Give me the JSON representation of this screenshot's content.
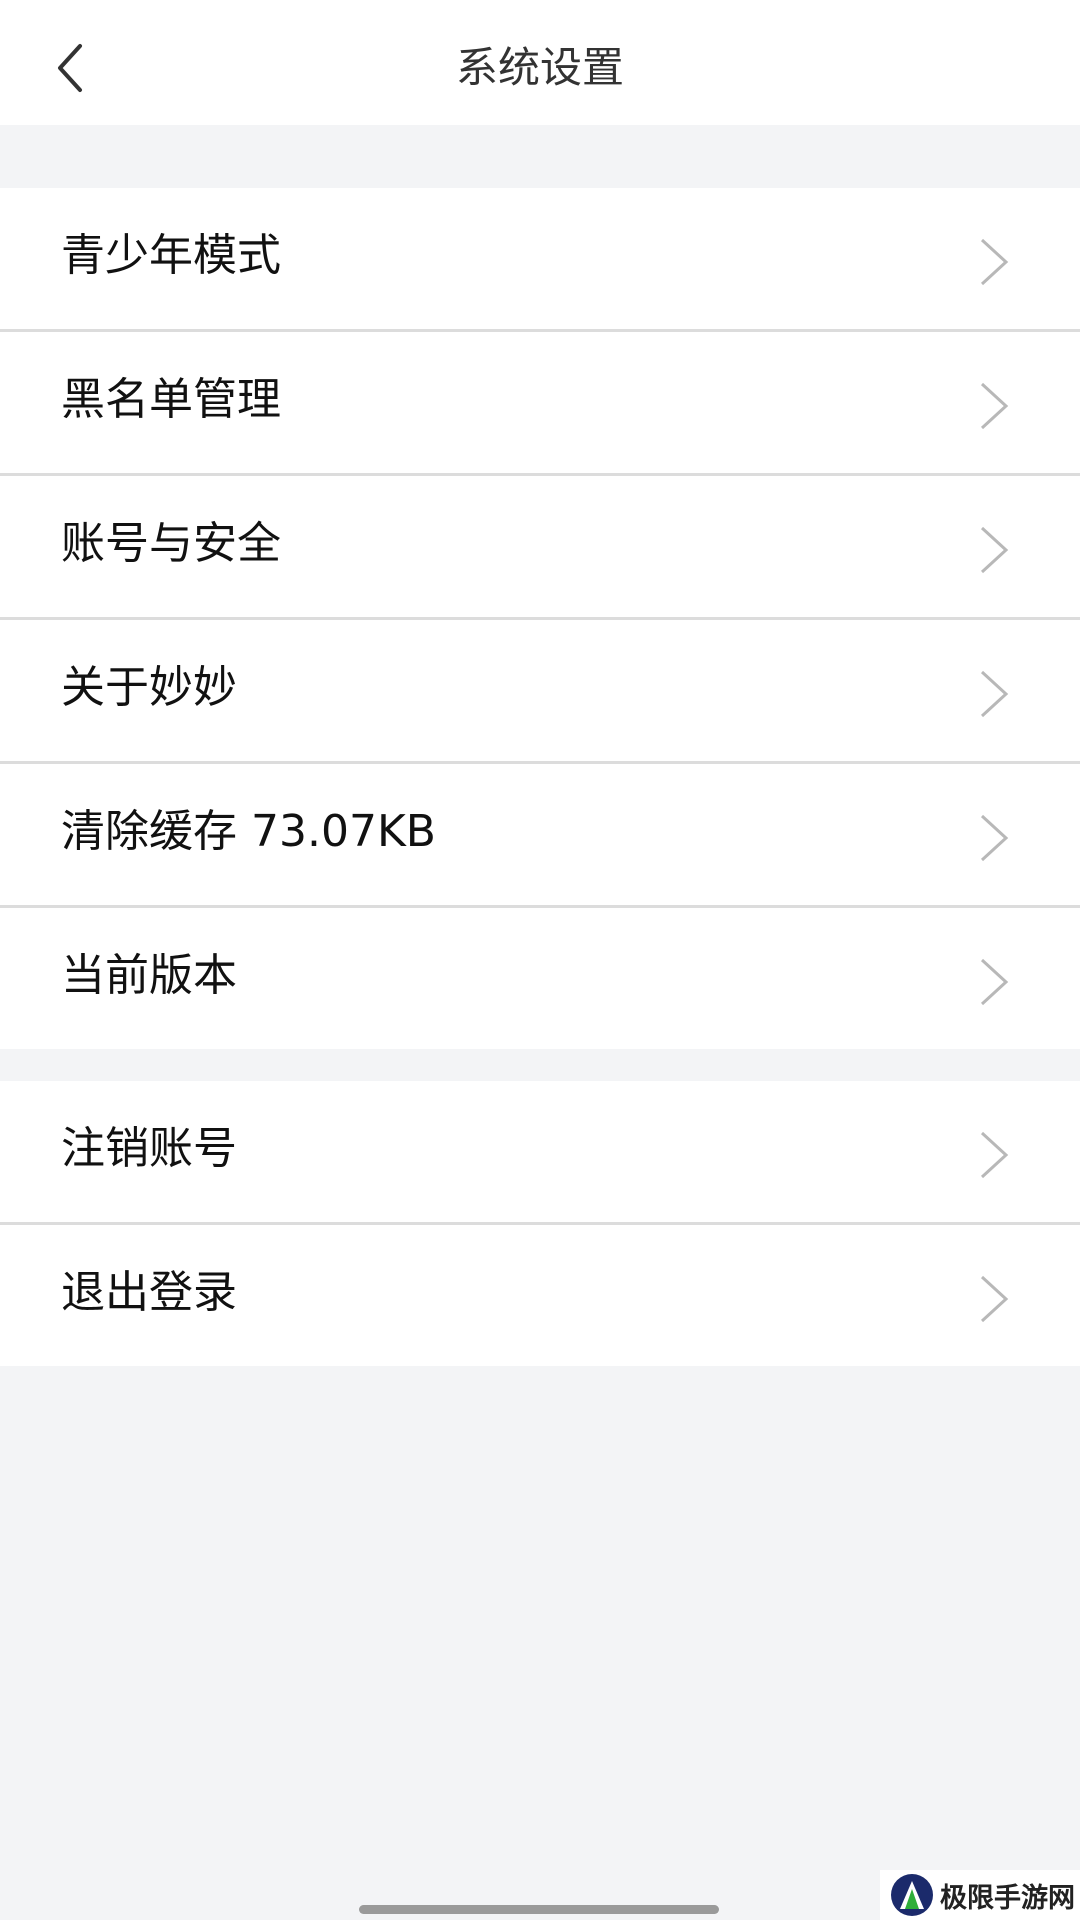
{
  "header": {
    "title": "系统设置",
    "back_icon": "chevron-left-icon"
  },
  "settings_group": [
    {
      "label": "青少年模式"
    },
    {
      "label": "黑名单管理"
    },
    {
      "label": "账号与安全"
    },
    {
      "label": "关于妙妙"
    },
    {
      "label": "清除缓存 73.07KB"
    },
    {
      "label": "当前版本"
    }
  ],
  "account_group": [
    {
      "label": "注销账号"
    },
    {
      "label": "退出登录"
    }
  ],
  "watermark": {
    "text": "极限手游网"
  },
  "colors": {
    "background": "#f3f4f6",
    "surface": "#ffffff",
    "divider": "#dcdcdc",
    "text_primary": "#111111",
    "title_text": "#333333",
    "chevron": "#b8b8b8"
  }
}
